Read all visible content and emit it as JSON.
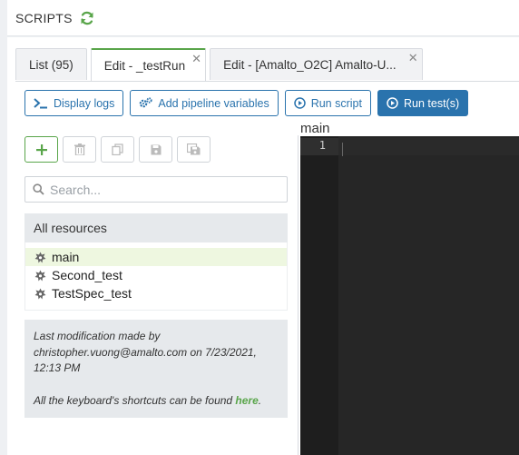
{
  "header": {
    "title": "SCRIPTS",
    "refresh_icon": "refresh-icon"
  },
  "tabs": [
    {
      "label": "List (95)",
      "active": false,
      "closable": false
    },
    {
      "label": "Edit - _testRun",
      "active": true,
      "closable": true
    },
    {
      "label": "Edit - [Amalto_O2C] Amalto-U...",
      "active": false,
      "closable": true
    }
  ],
  "toolbar": {
    "display_logs": "Display logs",
    "add_pipeline_variables": "Add pipeline variables",
    "run_script": "Run script",
    "run_tests": "Run test(s)"
  },
  "search": {
    "placeholder": "Search..."
  },
  "resources": {
    "header": "All resources",
    "items": [
      {
        "label": "main",
        "selected": true
      },
      {
        "label": "Second_test",
        "selected": false
      },
      {
        "label": "TestSpec_test",
        "selected": false
      }
    ]
  },
  "info": {
    "modification_line1": "Last modification made by",
    "modification_line2": "christopher.vuong@amalto.com on 7/23/2021,",
    "modification_line3": "12:13 PM",
    "shortcuts_prefix": "All the keyboard's shortcuts can be found ",
    "shortcuts_link": "here",
    "shortcuts_suffix": "."
  },
  "editor": {
    "title": "main",
    "line_number": "1"
  },
  "colors": {
    "accent_green": "#59a54a",
    "primary_blue": "#2a73ad",
    "editor_bg": "#262626"
  }
}
